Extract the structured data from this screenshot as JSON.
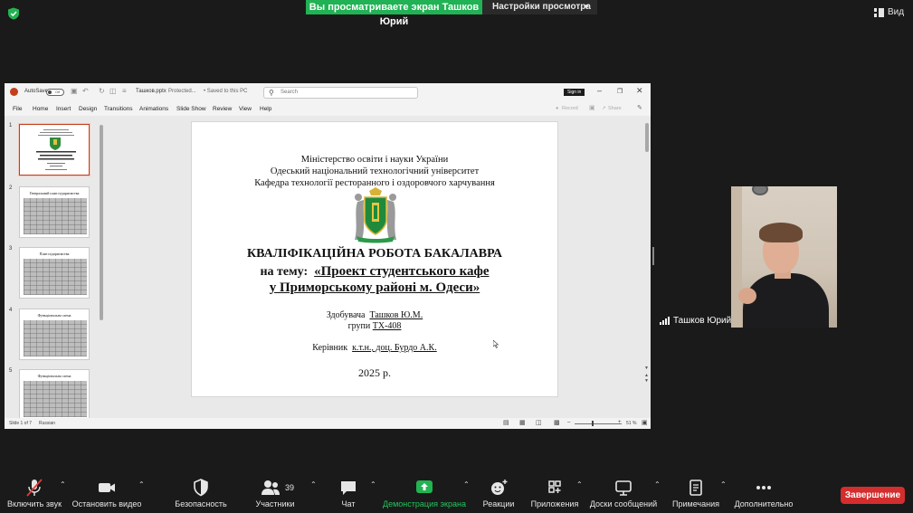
{
  "zoom_top": {
    "share_banner": "Вы просматриваете экран Ташков Юрий",
    "view_settings": "Настройки просмотра",
    "view_button": "Вид"
  },
  "ppt": {
    "titlebar": {
      "autosave": "AutoSave",
      "toggle_state": "Off",
      "filename": "Ташков.pptx",
      "protected": "Protected...",
      "saved": "• Saved to this PC",
      "search_placeholder": "Search",
      "sign_in": "Sign in"
    },
    "ribbon_tabs": [
      "File",
      "Home",
      "Insert",
      "Design",
      "Transitions",
      "Animations",
      "Slide Show",
      "Review",
      "View",
      "Help"
    ],
    "ribbon_right": {
      "record": "Record",
      "share": "Share"
    },
    "thumbnails": [
      {
        "num": "1",
        "title": "",
        "selected": true
      },
      {
        "num": "2",
        "title": "Генеральний план підприємства"
      },
      {
        "num": "3",
        "title": "План підприємства"
      },
      {
        "num": "4",
        "title": "Функціональна схема"
      },
      {
        "num": "5",
        "title": "Функціональна схема"
      }
    ],
    "slide": {
      "ministry": "Міністерство освіти і науки України",
      "university": "Одеський національний технологічний університет",
      "department": "Кафедра технології ресторанного і оздоровчого харчування",
      "work_title": "КВАЛІФІКАЦІЙНА РОБОТА БАКАЛАВРА",
      "topic_prefix": "на тему:",
      "topic_line1": "«Проект студентського кафе",
      "topic_line2": "у Приморському районі м. Одеси»",
      "student_label": "Здобувача",
      "student_name": "Ташков Ю.М.",
      "group_label": "групи",
      "group_name": "ТХ-408",
      "supervisor_label": "Керівник",
      "supervisor_name": "к.т.н., доц. Бурдо А.К.",
      "year": "2025 р."
    },
    "status": {
      "slide_info": "Slide 1 of 7",
      "language": "Russian",
      "zoom": "51 %"
    }
  },
  "participant": {
    "name": "Ташков Юрий"
  },
  "toolbar": {
    "unmute": "Включить звук",
    "start_video": "Остановить видео",
    "security": "Безопасность",
    "participants": "Участники",
    "participants_count": "39",
    "chat": "Чат",
    "share": "Демонстрация экрана",
    "reactions": "Реакции",
    "apps": "Приложения",
    "whiteboards": "Доски сообщений",
    "notes": "Примечания",
    "more": "Дополнительно",
    "end": "Завершение"
  }
}
